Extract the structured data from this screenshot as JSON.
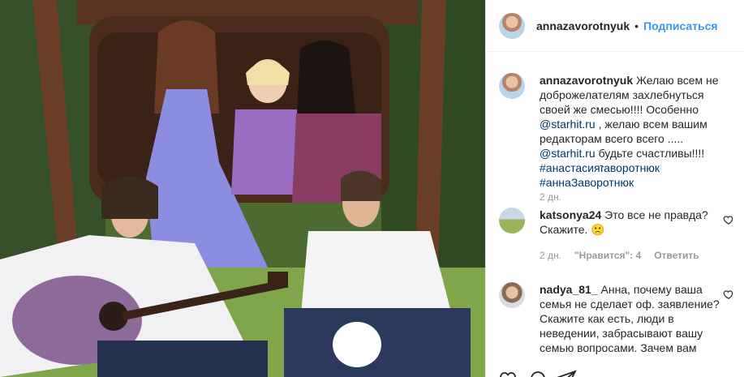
{
  "post": {
    "author": "annazavorotnyuk",
    "follow_label": "Подписаться",
    "separator": "•"
  },
  "caption": {
    "author": "annazavorotnyuk",
    "text_1": " Желаю всем не доброжелателям захлебнуться своей же смесью!!!! Особенно ",
    "mention_1": "@starhit.ru",
    "text_2": " , желаю всем вашим редакторам всего всего ..... ",
    "mention_2": "@starhit.ru",
    "text_3": " будьте счастливы!!!! ",
    "hashtag_1": "#анастасияזаворотнюк",
    "hashtag_2": "#аннаЗаворотнюк",
    "time": "2 дн."
  },
  "comments": [
    {
      "author": "katsonya24",
      "text": " Это все не правда? Скажите. 🙁",
      "time": "2 дн.",
      "likes": "\"Нравится\": 4",
      "reply": "Ответить"
    },
    {
      "author": "nadya_81_",
      "text": " Анна, почему ваша семья не сделает оф. заявление? Скажите как есть, люди в неведении, забрасывают вашу семью вопросами. Зачем вам",
      "time": "",
      "likes": "",
      "reply": ""
    }
  ],
  "icons": [
    "heart-icon",
    "comment-icon",
    "share-icon"
  ],
  "colors": {
    "link": "#003569",
    "follow": "#3897f0",
    "meta": "#999999"
  }
}
